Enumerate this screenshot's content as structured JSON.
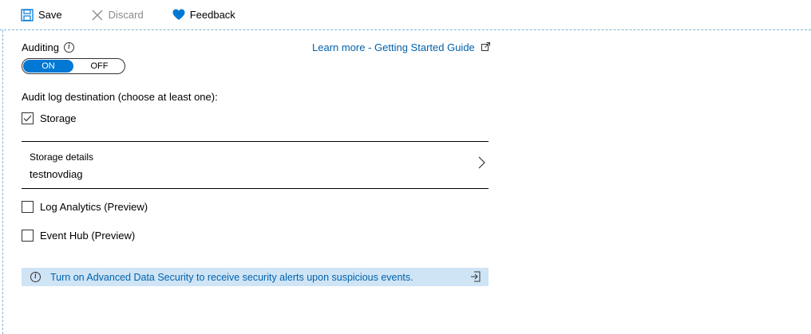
{
  "toolbar": {
    "save_label": "Save",
    "discard_label": "Discard",
    "feedback_label": "Feedback"
  },
  "auditing": {
    "label": "Auditing",
    "learn_more": "Learn more - Getting Started Guide",
    "toggle": {
      "on_label": "ON",
      "off_label": "OFF",
      "selected": "ON"
    }
  },
  "destination": {
    "heading": "Audit log destination (choose at least one):",
    "storage": {
      "label": "Storage",
      "checked": true
    },
    "storage_details": {
      "title": "Storage details",
      "value": "testnovdiag"
    },
    "log_analytics": {
      "label": "Log Analytics (Preview)",
      "checked": false
    },
    "event_hub": {
      "label": "Event Hub (Preview)",
      "checked": false
    }
  },
  "banner": {
    "message": "Turn on Advanced Data Security to receive security alerts upon suspicious events."
  },
  "colors": {
    "accent": "#0078d4",
    "link": "#0062ad",
    "banner_bg": "#cfe4f5"
  },
  "icons": [
    "save-icon",
    "close-icon",
    "heart-icon",
    "info-icon",
    "external-link-icon",
    "check-icon",
    "chevron-right-icon",
    "exit-icon"
  ]
}
